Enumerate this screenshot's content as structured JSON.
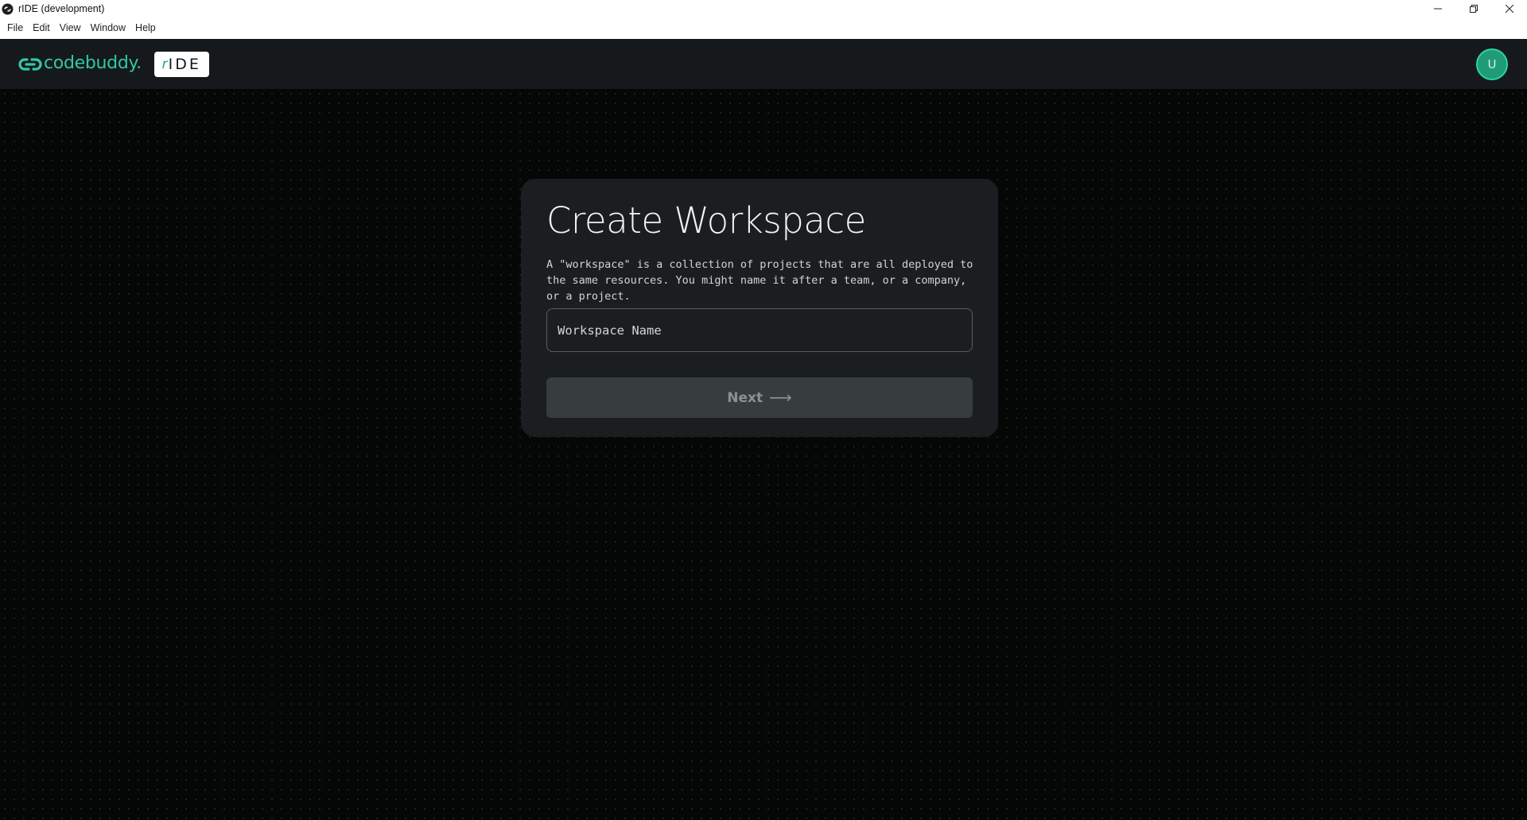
{
  "window": {
    "title": "rIDE (development)",
    "controls": {
      "minimize_icon": "minimize-icon",
      "restore_icon": "restore-icon",
      "close_icon": "close-icon"
    }
  },
  "menubar": {
    "items": [
      {
        "label": "File"
      },
      {
        "label": "Edit"
      },
      {
        "label": "View"
      },
      {
        "label": "Window"
      },
      {
        "label": "Help"
      }
    ]
  },
  "header": {
    "brand_name": "codebuddy.",
    "badge_prefix": "r",
    "badge_label": "IDE",
    "avatar_initial": "U",
    "colors": {
      "brand": "#34c7a3",
      "header_bg": "#15191c",
      "avatar_bg": "#1f9b78"
    }
  },
  "workspace_card": {
    "title": "Create Workspace",
    "description": "A \"workspace\" is a collection of projects that are all deployed to the same resources. You might name it after a team, or a company, or a project.",
    "name_input": {
      "placeholder": "Workspace Name",
      "value": ""
    },
    "next_label": "Next",
    "next_arrow": "⟶"
  }
}
